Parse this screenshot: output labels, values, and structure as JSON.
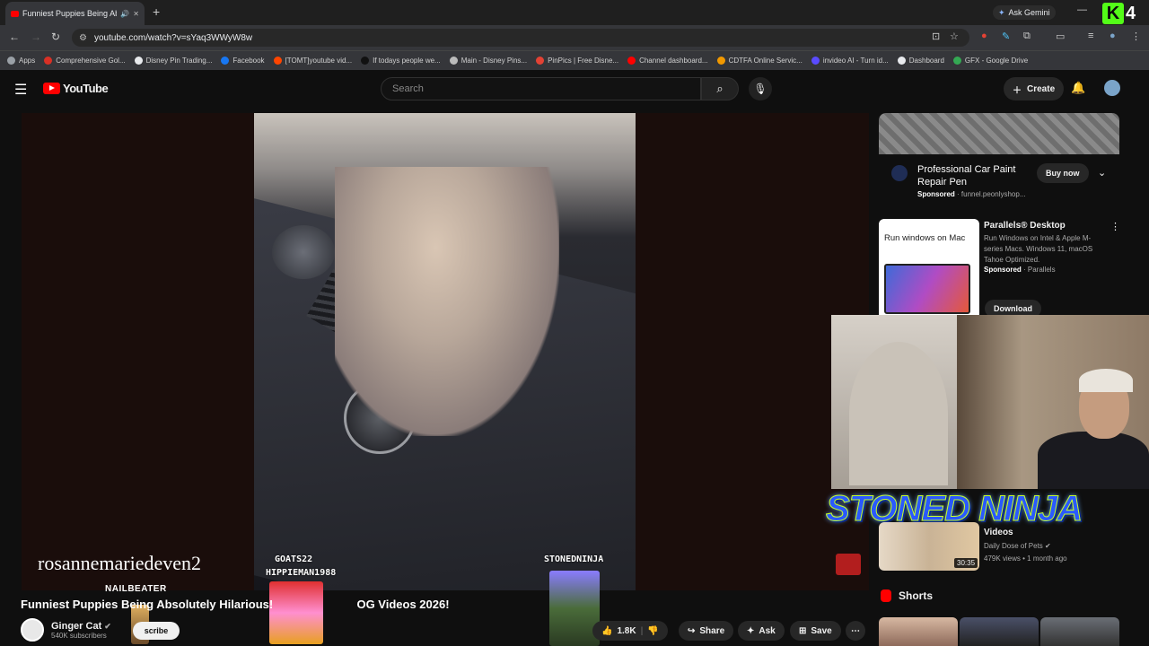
{
  "browser": {
    "tab_title": "Funniest Puppies Being Ab",
    "new_tab": "+",
    "url": "youtube.com/watch?v=sYaq3WWyW8w",
    "gemini_label": "Ask Gemini",
    "overlay_number": "4",
    "overlay_letter": "K",
    "bookmarks": [
      {
        "label": "Apps",
        "color": "#9aa0a6"
      },
      {
        "label": "Comprehensive Gol...",
        "color": "#d93025"
      },
      {
        "label": "Disney Pin Trading...",
        "color": "#e8eaed"
      },
      {
        "label": "Facebook",
        "color": "#1877f2"
      },
      {
        "label": "[TOMT]youtube vid...",
        "color": "#ff4500"
      },
      {
        "label": "If todays people we...",
        "color": "#111111"
      },
      {
        "label": "Main - Disney Pins...",
        "color": "#bbbbbb"
      },
      {
        "label": "PinPics | Free Disne...",
        "color": "#e34234"
      },
      {
        "label": "Channel dashboard...",
        "color": "#ff0000"
      },
      {
        "label": "CDTFA Online Servic...",
        "color": "#f29900"
      },
      {
        "label": "invideo AI - Turn id...",
        "color": "#5a4bff"
      },
      {
        "label": "Dashboard",
        "color": "#e8eaed"
      },
      {
        "label": "GFX - Google Drive",
        "color": "#34a853"
      }
    ]
  },
  "youtube": {
    "logo_text": "YouTube",
    "search_placeholder": "Search",
    "create_label": "Create"
  },
  "video": {
    "overlay_channel": "rosannemariedeven2",
    "tag_nailbeater": "NAILBEATER",
    "tag_goats": "GOATS22",
    "tag_hippie": "HIPPIEMAN1988",
    "tag_stoned": "STONEDNINJA",
    "title_part1": "Funniest Puppies Being Absolutely Hilarious!",
    "title_part2": "OG Videos 2026!",
    "channel_name": "Ginger Cat",
    "subscribers": "540K subscribers",
    "subscribe_label": "scribe",
    "likes": "1.8K",
    "share_label": "Share",
    "ask_label": "Ask",
    "save_label": "Save"
  },
  "sidebar": {
    "ad1": {
      "title": "Professional Car Paint Repair Pen",
      "sponsored": "Sponsored",
      "domain": "funnel.peonlyshop...",
      "cta": "Buy now"
    },
    "ad2": {
      "title": "Parallels® Desktop",
      "thumb_text": "Run windows on Mac",
      "description": "Run Windows on Intel & Apple M-series Macs. Windows 11, macOS Tahoe Optimized.",
      "sponsored": "Sponsored",
      "advertiser": "Parallels",
      "cta": "Download"
    },
    "stream_overlay": "STONED NINJA",
    "rec": {
      "title": "Videos",
      "channel": "Daily Dose of Pets",
      "meta": "479K views • 1 month ago",
      "duration": "30:35"
    },
    "shorts_label": "Shorts"
  }
}
